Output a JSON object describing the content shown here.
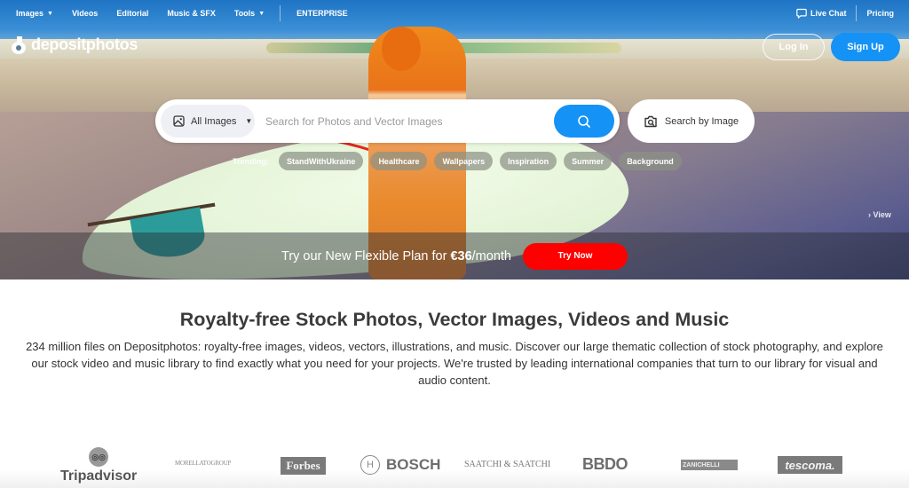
{
  "nav": {
    "items": [
      {
        "label": "Images",
        "has_caret": true
      },
      {
        "label": "Videos",
        "has_caret": false
      },
      {
        "label": "Editorial",
        "has_caret": false
      },
      {
        "label": "Music & SFX",
        "has_caret": false
      },
      {
        "label": "Tools",
        "has_caret": true
      }
    ],
    "enterprise": "ENTERPRISE",
    "live_chat": "Live Chat",
    "pricing": "Pricing"
  },
  "brand": {
    "name": "depositphotos"
  },
  "auth": {
    "login": "Log In",
    "signup": "Sign Up"
  },
  "search": {
    "type_label": "All Images",
    "placeholder": "Search for Photos and Vector Images",
    "value": "",
    "search_by_image": "Search by Image"
  },
  "trending": {
    "label": "Trending:",
    "chips": [
      "StandWithUkraine",
      "Healthcare",
      "Wallpapers",
      "Inspiration",
      "Summer",
      "Background"
    ]
  },
  "hero": {
    "view_link": "› View"
  },
  "promo": {
    "text_before": "Try our New Flexible Plan for ",
    "price": "€36",
    "text_after": "/month",
    "button": "Try Now"
  },
  "main": {
    "headline": "Royalty-free Stock Photos, Vector Images, Videos and Music",
    "description": "234 million files on Depositphotos: royalty-free images, videos, vectors, illustrations, and music. Discover our large thematic collection of stock photography, and explore our stock video and music library to find exactly what you need for your projects. We're trusted by leading international companies that turn to our library for visual and audio content."
  },
  "clients": {
    "tripadvisor": "Tripadvisor",
    "morellato": "MORELLATOGROUP",
    "forbes": "Forbes",
    "bosch": "BOSCH",
    "saatchi": "SAATCHI & SAATCHI",
    "bbdo": "BBDO",
    "zanichelli": "ZANICHELLI",
    "tescoma": "tescoma."
  },
  "colors": {
    "accent_blue": "#1592f5",
    "promo_red": "#ff0000",
    "headline_text": "#3a3a3a"
  }
}
